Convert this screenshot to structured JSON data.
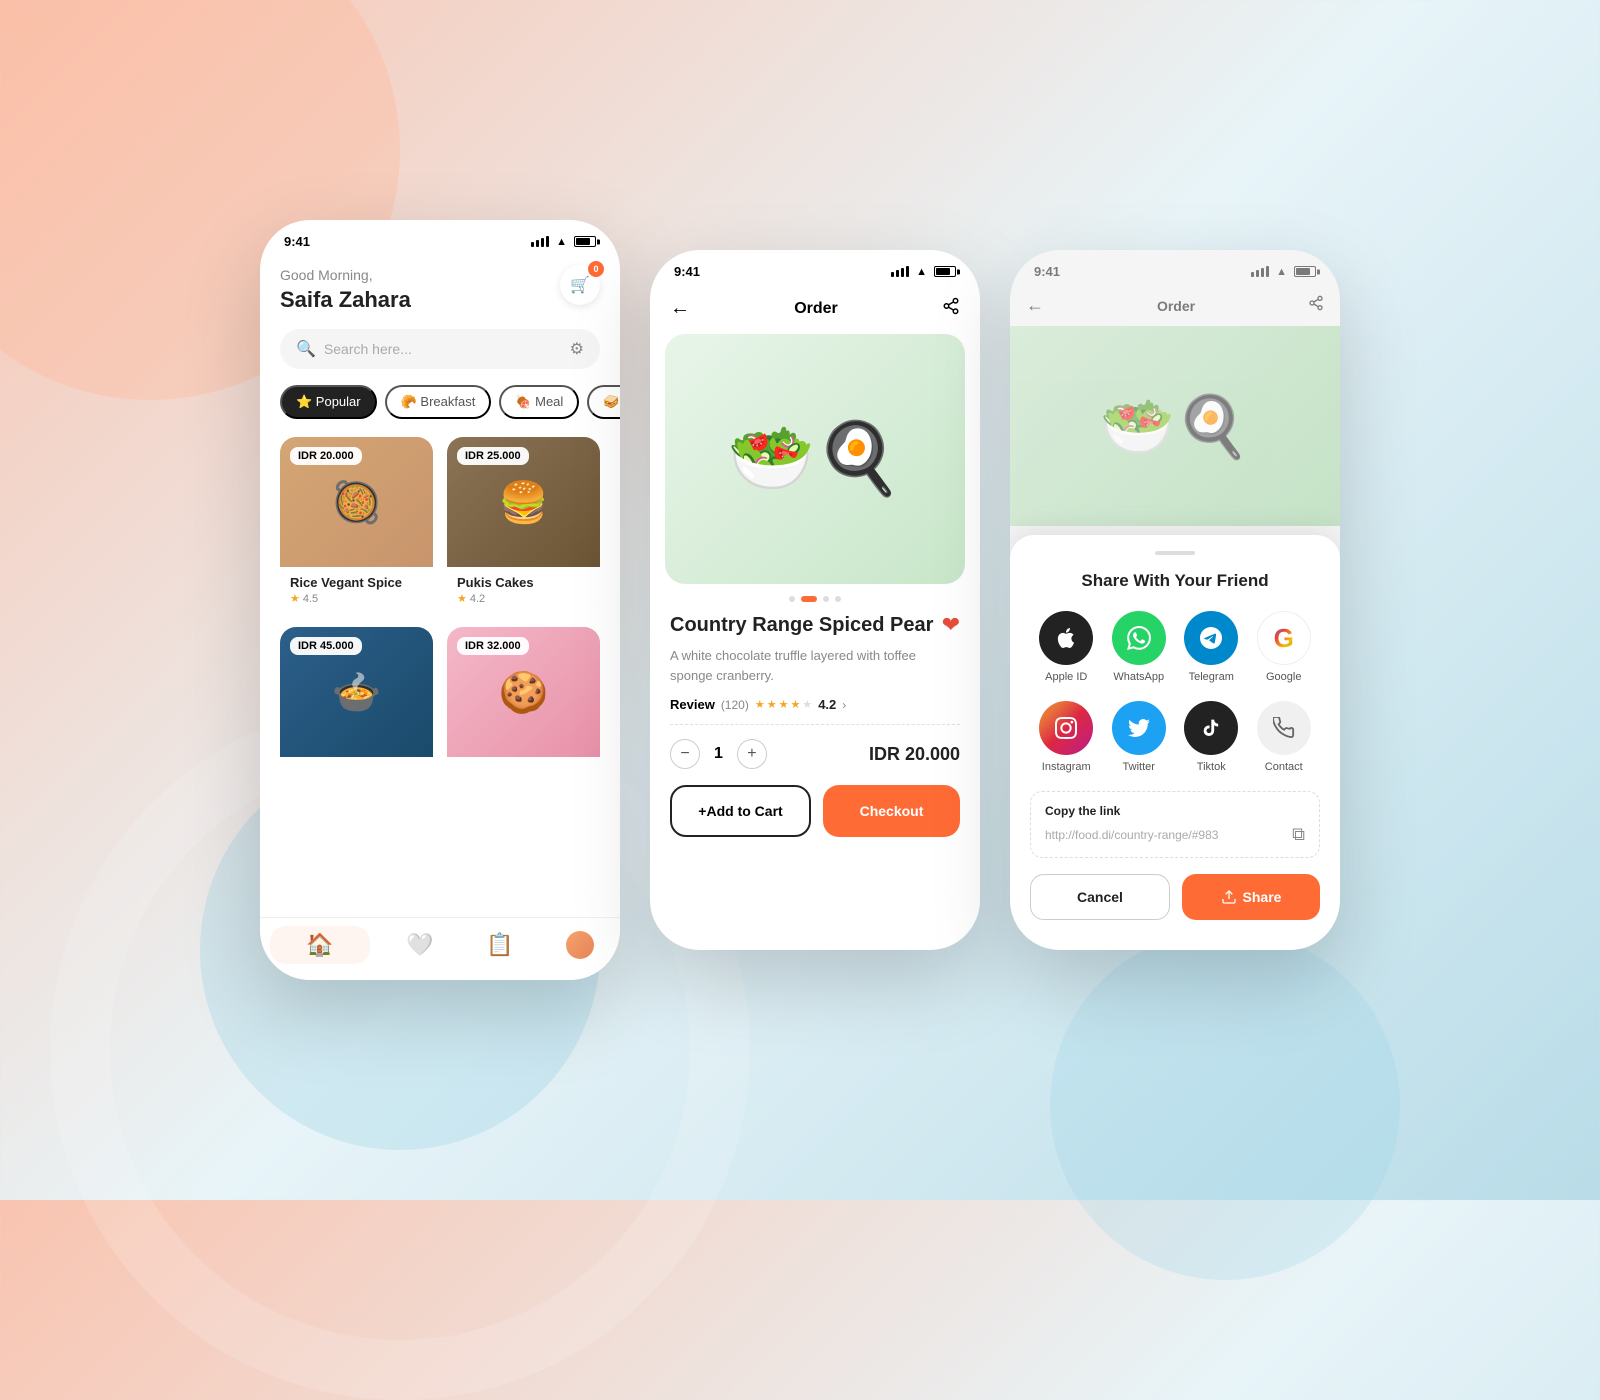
{
  "background": {
    "description": "Food delivery app UI with 3 phone screens"
  },
  "phone1": {
    "status_time": "9:41",
    "greeting": "Good Morning,",
    "username": "Saifa Zahara",
    "cart_badge": "0",
    "search_placeholder": "Search here...",
    "categories": [
      {
        "label": "⭐ Popular",
        "active": true
      },
      {
        "label": "🥐 Breakfast",
        "active": false
      },
      {
        "label": "🍖 Meal",
        "active": false
      },
      {
        "label": "🥪 Snack",
        "active": false
      }
    ],
    "foods": [
      {
        "name": "Rice Vegant Spice",
        "price": "IDR 20.000",
        "rating": "4.5"
      },
      {
        "name": "Pukis Cakes",
        "price": "IDR 25.000",
        "rating": "4.2"
      },
      {
        "name": "",
        "price": "IDR 45.000",
        "rating": ""
      },
      {
        "name": "",
        "price": "IDR 32.000",
        "rating": ""
      }
    ],
    "nav": [
      "home",
      "heart",
      "list",
      "profile"
    ]
  },
  "phone2": {
    "status_time": "9:41",
    "header_title": "Order",
    "food_name": "Country Range Spiced Pear",
    "food_description": "A white chocolate truffle layered with toffee sponge cranberry.",
    "review_label": "Review",
    "review_count": "(120)",
    "review_score": "4.2",
    "quantity": "1",
    "total_price": "IDR 20.000",
    "add_to_cart": "+Add to Cart",
    "checkout": "Checkout"
  },
  "phone3": {
    "status_time": "9:41",
    "header_title": "Order",
    "share_title": "Share With Your Friend",
    "share_icons": [
      {
        "name": "Apple ID",
        "icon": "apple",
        "style": "apple"
      },
      {
        "name": "WhatsApp",
        "icon": "whatsapp",
        "style": "whatsapp"
      },
      {
        "name": "Telegram",
        "icon": "telegram",
        "style": "telegram"
      },
      {
        "name": "Google",
        "icon": "google",
        "style": "google"
      },
      {
        "name": "Instagram",
        "icon": "instagram",
        "style": "instagram"
      },
      {
        "name": "Twitter",
        "icon": "twitter",
        "style": "twitter"
      },
      {
        "name": "Tiktok",
        "icon": "tiktok",
        "style": "tiktok"
      },
      {
        "name": "Contact",
        "icon": "contact",
        "style": "contact"
      }
    ],
    "copy_link_label": "Copy the link",
    "link_url": "http://food.di/country-range/#983",
    "cancel_label": "Cancel",
    "share_label": "Share"
  }
}
